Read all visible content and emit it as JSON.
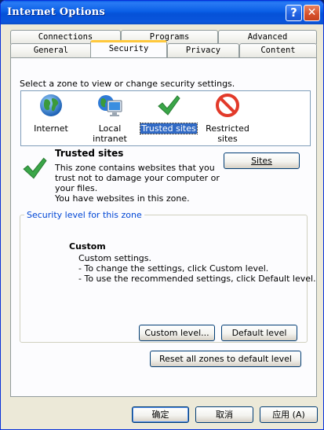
{
  "window": {
    "title": "Internet Options",
    "help_glyph": "?",
    "close_glyph": "✕"
  },
  "tabs": {
    "row_back": [
      "Connections",
      "Programs",
      "Advanced"
    ],
    "row_front": [
      "General",
      "Security",
      "Privacy",
      "Content"
    ],
    "active": "Security"
  },
  "security": {
    "prompt": "Select a zone to view or change security settings.",
    "zones": [
      {
        "label": "Internet",
        "icon": "globe-icon"
      },
      {
        "label": "Local intranet",
        "icon": "intranet-icon"
      },
      {
        "label": "Trusted sites",
        "icon": "checkmark-icon",
        "selected": true
      },
      {
        "label_line1": "Restricted",
        "label_line2": "sites",
        "icon": "restricted-icon"
      }
    ],
    "zone_title": "Trusted sites",
    "zone_desc": [
      "This zone contains websites that you",
      "trust not to damage your computer or",
      "your files.",
      "You have websites in this zone."
    ],
    "sites_button": "Sites",
    "group_legend": "Security level for this zone",
    "level_title": "Custom",
    "level_desc": [
      "Custom settings.",
      "- To change the settings, click Custom level.",
      "- To use the recommended settings, click Default level."
    ],
    "custom_level_button": "Custom level...",
    "default_level_button": "Default level",
    "reset_button": "Reset all zones to default level"
  },
  "footer": {
    "ok": "确定",
    "cancel": "取消",
    "apply": "应用 (A)"
  },
  "colors": {
    "selection": "#316ac5",
    "title_bar": "#0a5ce8",
    "active_tab_accent": "#ffc83c",
    "check_green": "#3aa648",
    "restricted_red": "#e23a2a"
  }
}
